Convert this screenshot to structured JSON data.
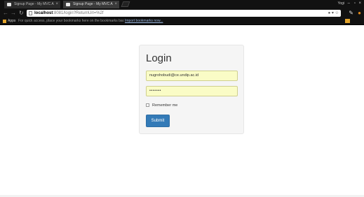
{
  "browser": {
    "tabs": [
      {
        "label": "Signup Page - My MVC A"
      },
      {
        "label": "Signup Page - My MVC A"
      }
    ],
    "user_label": "Yogi",
    "url_host": "localhost",
    "url_rest": ":8081/login?ReturnUrl=%2f",
    "bookmarks": {
      "apps_label": "Apps",
      "hint": "For quick access, place your bookmarks here on the bookmarks bar.",
      "import_link": "Import bookmarks now..."
    }
  },
  "login": {
    "title": "Login",
    "email_value": "nugrohobudi@ce.undip.ac.id",
    "password_value": "•••••••",
    "remember_label": "Remember me",
    "submit_label": "Submit"
  },
  "colors": {
    "primary_button": "#337ab7",
    "autofill_field": "#fafcc6"
  }
}
